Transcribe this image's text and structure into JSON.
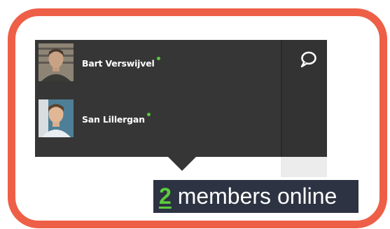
{
  "members": [
    {
      "name": "Bart Verswijvel",
      "status": "online"
    },
    {
      "name": "San Lillergan",
      "status": "online"
    }
  ],
  "online_summary": {
    "count": "2",
    "label": "members online"
  },
  "icons": {
    "chat": "speech-bubble-icon",
    "status": "online-status-dot-icon",
    "avatar": "user-photo"
  },
  "colors": {
    "highlight": "#ee5f47",
    "panel": "#363636",
    "online": "#5ccc3c",
    "caption": "#2d3342"
  }
}
